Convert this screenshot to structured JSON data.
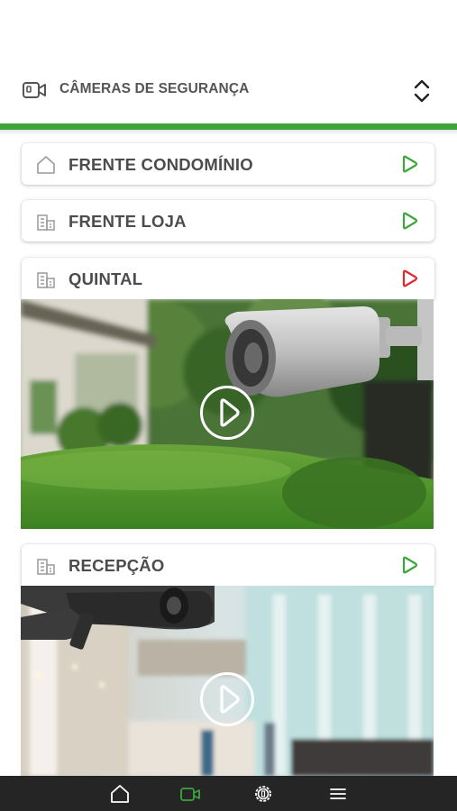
{
  "header": {
    "title": "CÂMERAS DE SEGURANÇA",
    "icon": "video-camera-icon",
    "toggle_icon": "chevron-up-down-icon"
  },
  "colors": {
    "accent_green": "#3ca53c",
    "status_red": "#e0282d",
    "nav_bg": "#252525"
  },
  "cameras": [
    {
      "label": "FRENTE CONDOMÍNIO",
      "icon": "home-icon",
      "status": "green",
      "expanded": false
    },
    {
      "label": "FRENTE LOJA",
      "icon": "building-icon",
      "status": "green",
      "expanded": false
    },
    {
      "label": "QUINTAL",
      "icon": "building-icon",
      "status": "red",
      "expanded": true
    },
    {
      "label": "RECEPÇÃO",
      "icon": "building-icon",
      "status": "green",
      "expanded": true
    }
  ],
  "bottom_nav": [
    {
      "icon": "home-icon",
      "active": false
    },
    {
      "icon": "video-camera-icon",
      "active": true
    },
    {
      "icon": "settings-icon",
      "active": false
    },
    {
      "icon": "menu-icon",
      "active": false
    }
  ]
}
